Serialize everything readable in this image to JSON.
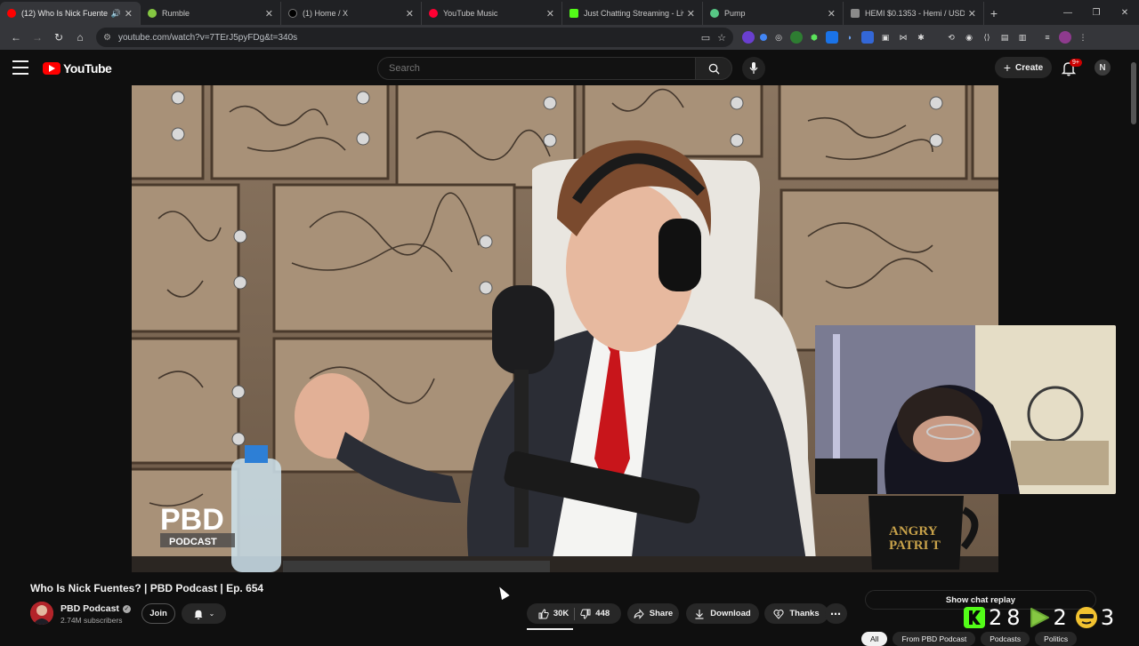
{
  "browser": {
    "tabs": [
      {
        "title": "(12) Who Is Nick Fuentes? |",
        "color": "#ff0000",
        "active": true
      },
      {
        "title": "Rumble",
        "color": "#85c742",
        "active": false
      },
      {
        "title": "(1) Home / X",
        "color": "#000000",
        "active": false
      },
      {
        "title": "YouTube Music",
        "color": "#ff0033",
        "active": false
      },
      {
        "title": "Just Chatting Streaming - Live S",
        "color": "#53fc18",
        "active": false
      },
      {
        "title": "Pump",
        "color": "#57c785",
        "active": false
      },
      {
        "title": "HEMI $0.1353 - Hemi / USDT o",
        "color": "#8a8a8a",
        "active": false
      }
    ],
    "url": "youtube.com/watch?v=7TErJ5pyFDg&t=340s"
  },
  "masthead": {
    "logo_text": "YouTube",
    "search_placeholder": "Search",
    "create_label": "Create",
    "notif_badge": "9+",
    "avatar_initial": "N"
  },
  "video": {
    "title": "Who Is Nick Fuentes? | PBD Podcast | Ep. 654",
    "channel": "PBD Podcast",
    "subscribers": "2.74M subscribers",
    "join_label": "Join",
    "likes": "30K",
    "dislikes": "448",
    "share_label": "Share",
    "download_label": "Download",
    "thanks_label": "Thanks",
    "watermark_line1": "PBD",
    "watermark_line2": "PODCAST",
    "mug_text_1": "ANGRY",
    "mug_text_2": "PATRI T"
  },
  "sidebar": {
    "chat_replay_label": "Show chat replay",
    "chips": [
      "All",
      "From PBD Podcast",
      "Podcasts",
      "Politics"
    ]
  },
  "stream_overlay": {
    "kick_count": "28",
    "rumble_count": "2",
    "emote_count": "3"
  }
}
